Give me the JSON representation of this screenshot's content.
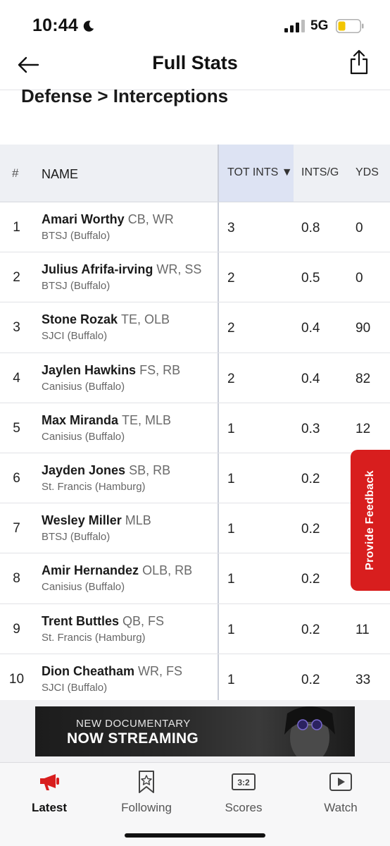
{
  "status": {
    "time": "10:44",
    "network": "5G"
  },
  "nav": {
    "title": "Full Stats"
  },
  "section": {
    "title": "Defense > Interceptions"
  },
  "table": {
    "headers": {
      "rank": "#",
      "name": "NAME",
      "tot": "TOT INTS ▼",
      "intsg": "INTS/G",
      "yds": "YDS"
    },
    "rows": [
      {
        "rank": "1",
        "name": "Amari Worthy",
        "pos": "CB, WR",
        "team": "BTSJ (Buffalo)",
        "tot": "3",
        "intsg": "0.8",
        "yds": "0"
      },
      {
        "rank": "2",
        "name": "Julius Afrifa-irving",
        "pos": "WR, SS",
        "team": "BTSJ (Buffalo)",
        "tot": "2",
        "intsg": "0.5",
        "yds": "0"
      },
      {
        "rank": "3",
        "name": "Stone Rozak",
        "pos": "TE, OLB",
        "team": "SJCI (Buffalo)",
        "tot": "2",
        "intsg": "0.4",
        "yds": "90"
      },
      {
        "rank": "4",
        "name": "Jaylen Hawkins",
        "pos": "FS, RB",
        "team": "Canisius (Buffalo)",
        "tot": "2",
        "intsg": "0.4",
        "yds": "82"
      },
      {
        "rank": "5",
        "name": "Max Miranda",
        "pos": "TE, MLB",
        "team": "Canisius (Buffalo)",
        "tot": "1",
        "intsg": "0.3",
        "yds": "12"
      },
      {
        "rank": "6",
        "name": "Jayden Jones",
        "pos": "SB, RB",
        "team": "St. Francis (Hamburg)",
        "tot": "1",
        "intsg": "0.2",
        "yds": ""
      },
      {
        "rank": "7",
        "name": "Wesley Miller",
        "pos": "MLB",
        "team": "BTSJ (Buffalo)",
        "tot": "1",
        "intsg": "0.2",
        "yds": ""
      },
      {
        "rank": "8",
        "name": "Amir Hernandez",
        "pos": "OLB, RB",
        "team": "Canisius (Buffalo)",
        "tot": "1",
        "intsg": "0.2",
        "yds": ""
      },
      {
        "rank": "9",
        "name": "Trent Buttles",
        "pos": "QB, FS",
        "team": "St. Francis (Hamburg)",
        "tot": "1",
        "intsg": "0.2",
        "yds": "11"
      },
      {
        "rank": "10",
        "name": "Dion Cheatham",
        "pos": "WR, FS",
        "team": "SJCI (Buffalo)",
        "tot": "1",
        "intsg": "0.2",
        "yds": "33"
      }
    ]
  },
  "feedback": {
    "label": "Provide Feedback"
  },
  "ad": {
    "line1": "NEW DOCUMENTARY",
    "line2": "NOW STREAMING"
  },
  "tabs": [
    {
      "label": "Latest",
      "icon": "megaphone-icon",
      "active": true
    },
    {
      "label": "Following",
      "icon": "bookmark-star-icon",
      "active": false
    },
    {
      "label": "Scores",
      "icon": "scoreboard-icon",
      "active": false
    },
    {
      "label": "Watch",
      "icon": "play-icon",
      "active": false
    }
  ],
  "colors": {
    "accent": "#d81e1e",
    "sorted_column": "#dde3f3",
    "header_bg": "#eef0f4"
  }
}
